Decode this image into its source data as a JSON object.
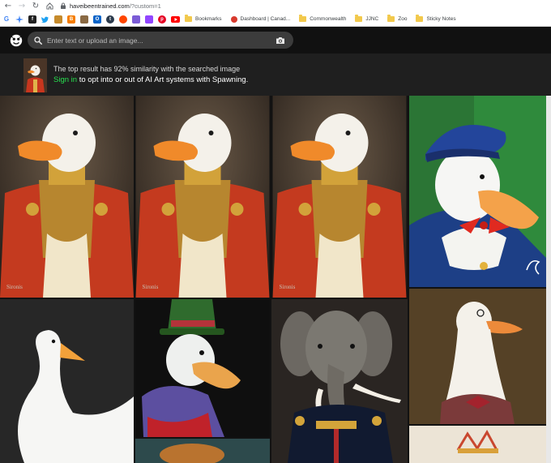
{
  "browser": {
    "url_host": "haveibeentrained.com",
    "url_path": "/?custom=1",
    "bookmarks": [
      {
        "label": "Bookmarks"
      },
      {
        "label": "Dashboard | Canad..."
      },
      {
        "label": "Commonwealth"
      },
      {
        "label": "JJNC"
      },
      {
        "label": "Zoo"
      },
      {
        "label": "Sticky Notes"
      }
    ]
  },
  "search": {
    "placeholder": "Enter text or upload an image..."
  },
  "notice": {
    "line1": "The top result has 92% similarity with the searched image",
    "signin_label": "Sign in",
    "line2_rest": " to opt into or out of AI Art systems with Spawning."
  },
  "results": [
    {
      "name": "result-duck-uniform-1",
      "watermark": "Sironis"
    },
    {
      "name": "result-duck-uniform-2",
      "watermark": "Sironis"
    },
    {
      "name": "result-duck-uniform-3",
      "watermark": "Sironis"
    },
    {
      "name": "result-duck-sailor"
    },
    {
      "name": "result-white-goose"
    },
    {
      "name": "result-duck-top-hat"
    },
    {
      "name": "result-elephant-uniform"
    },
    {
      "name": "result-goose-monocle"
    }
  ]
}
